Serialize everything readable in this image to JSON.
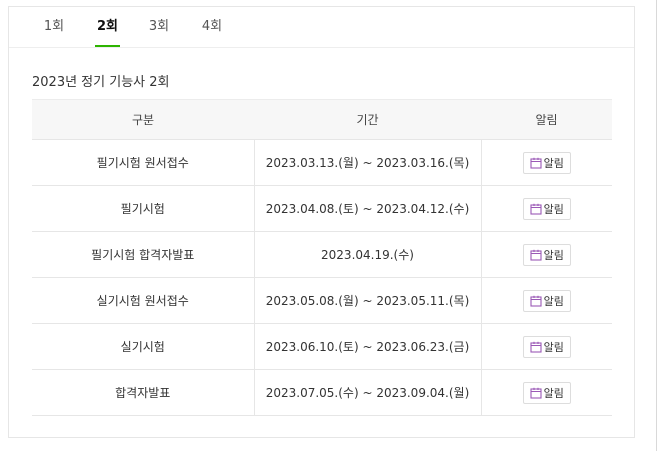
{
  "tabs": [
    {
      "label": "1회",
      "active": false
    },
    {
      "label": "2회",
      "active": true
    },
    {
      "label": "3회",
      "active": false
    },
    {
      "label": "4회",
      "active": false
    }
  ],
  "exam_title": "2023년 정기 기능사 2회",
  "table": {
    "headers": {
      "category": "구분",
      "period": "기간",
      "notify": "알림"
    },
    "rows": [
      {
        "category": "필기시험 원서접수",
        "period": "2023.03.13.(월) ~ 2023.03.16.(목)",
        "notify": "알림"
      },
      {
        "category": "필기시험",
        "period": "2023.04.08.(토) ~ 2023.04.12.(수)",
        "notify": "알림"
      },
      {
        "category": "필기시험 합격자발표",
        "period": "2023.04.19.(수)",
        "notify": "알림"
      },
      {
        "category": "실기시험 원서접수",
        "period": "2023.05.08.(월) ~ 2023.05.11.(목)",
        "notify": "알림"
      },
      {
        "category": "실기시험",
        "period": "2023.06.10.(토) ~ 2023.06.23.(금)",
        "notify": "알림"
      },
      {
        "category": "합격자발표",
        "period": "2023.07.05.(수) ~ 2023.09.04.(월)",
        "notify": "알림"
      }
    ]
  },
  "icons": {
    "notify_icon": "calendar-icon"
  },
  "colors": {
    "active_tab_underline": "#2db400",
    "calendar_icon": "#9b59b6"
  }
}
